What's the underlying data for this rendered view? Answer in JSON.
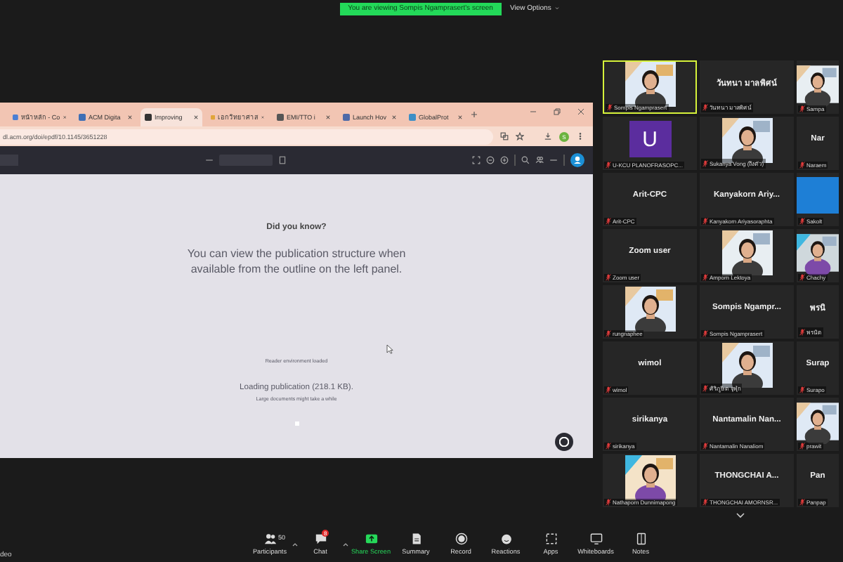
{
  "banner": {
    "text": "You are viewing Sompis Ngamprasert's screen",
    "options": "View Options"
  },
  "browser": {
    "tabs": [
      {
        "title": "หน้าหลัก - Co",
        "selected": false
      },
      {
        "title": "ACM Digita",
        "selected": false
      },
      {
        "title": "Improving",
        "selected": true
      },
      {
        "title": "เอกวิทยาศาส",
        "selected": false
      },
      {
        "title": "EMI/TTO i",
        "selected": false
      },
      {
        "title": "Launch Hov",
        "selected": false
      },
      {
        "title": "GlobalProt",
        "selected": false
      }
    ],
    "address": "dl.acm.org/doi/epdf/10.1145/3651228",
    "profile_letter": "S"
  },
  "reader": {
    "heading": "Did you know?",
    "tip": "You can view the publication structure when available from the outline on the left panel.",
    "status": "Reader environment loaded",
    "loading": "Loading publication (218.1 KB).",
    "note": "Large documents might take a while"
  },
  "gallery": [
    {
      "kind": "picture",
      "label": "Sompis Ngamprasert",
      "speaking": true,
      "muted": true
    },
    {
      "kind": "name",
      "name": "วันทนา มาลพิศน์",
      "label": "วันทนา มาลพิศน์",
      "speaking": false,
      "muted": true
    },
    {
      "kind": "picture",
      "label": "Sampa",
      "speaking": false,
      "muted": true
    },
    {
      "kind": "avatar",
      "name": "U",
      "color": "#5b2d9e",
      "label": "U-KCU PLANOFRASOPC...",
      "speaking": false,
      "muted": true
    },
    {
      "kind": "picture",
      "label": "Sukanya Vong (ถึงตัว)",
      "speaking": false,
      "muted": true
    },
    {
      "kind": "name",
      "name": "Nar",
      "label": "Naraem",
      "speaking": false,
      "muted": true
    },
    {
      "kind": "name",
      "name": "Arit-CPC",
      "label": "Arit-CPC",
      "speaking": false,
      "muted": true
    },
    {
      "kind": "name",
      "name": "Kanyakorn Ariy...",
      "label": "Kanyakorn Ariyasoraphta",
      "speaking": false,
      "muted": true
    },
    {
      "kind": "avatar",
      "color": "#1e7fd6",
      "label": "Sakolt",
      "speaking": false,
      "muted": true
    },
    {
      "kind": "name",
      "name": "Zoom user",
      "label": "Zoom user",
      "speaking": false,
      "muted": true
    },
    {
      "kind": "picture",
      "label": "Amporn Lektoya",
      "speaking": false,
      "muted": true
    },
    {
      "kind": "picture",
      "label": "Chachy",
      "speaking": false,
      "muted": true
    },
    {
      "kind": "picture",
      "label": "rungnaphee",
      "speaking": false,
      "muted": true
    },
    {
      "kind": "name",
      "name": "Sompis Ngampr...",
      "label": "Sompis Ngamprasert",
      "speaking": false,
      "muted": true
    },
    {
      "kind": "name",
      "name": "พรนิ",
      "label": "พรนิต",
      "speaking": false,
      "muted": true
    },
    {
      "kind": "name",
      "name": "wimol",
      "label": "wimol",
      "speaking": false,
      "muted": true
    },
    {
      "kind": "picture",
      "label": "ศิริภูษิต จุฬุก",
      "speaking": false,
      "muted": true
    },
    {
      "kind": "name",
      "name": "Surap",
      "label": "Surapo",
      "speaking": false,
      "muted": true
    },
    {
      "kind": "name",
      "name": "sirikanya",
      "label": "sirikanya",
      "speaking": false,
      "muted": true
    },
    {
      "kind": "name",
      "name": "Nantamalin Nan...",
      "label": "Nantamalin Nanaliom",
      "speaking": false,
      "muted": true
    },
    {
      "kind": "picture",
      "label": "prawit",
      "speaking": false,
      "muted": true
    },
    {
      "kind": "picture",
      "label": "Nathaporn Dunnimapong",
      "speaking": false,
      "muted": true
    },
    {
      "kind": "name",
      "name": "THONGCHAI A...",
      "label": "THONGCHAI AMORNSR...",
      "speaking": false,
      "muted": true
    },
    {
      "kind": "name",
      "name": "Pan",
      "label": "Panpap",
      "speaking": false,
      "muted": true
    }
  ],
  "toolbar": {
    "left": "deo",
    "items": [
      {
        "kind": "participants",
        "label": "Participants",
        "count": "50",
        "active": false
      },
      {
        "kind": "chat",
        "label": "Chat",
        "badge": "8",
        "active": false
      },
      {
        "kind": "share",
        "label": "Share Screen",
        "active": true
      },
      {
        "kind": "summary",
        "label": "Summary",
        "active": false
      },
      {
        "kind": "record",
        "label": "Record",
        "active": false
      },
      {
        "kind": "reactions",
        "label": "Reactions",
        "active": false
      },
      {
        "kind": "apps",
        "label": "Apps",
        "active": false
      },
      {
        "kind": "whiteboards",
        "label": "Whiteboards",
        "active": false
      },
      {
        "kind": "notes",
        "label": "Notes",
        "active": false
      }
    ]
  }
}
